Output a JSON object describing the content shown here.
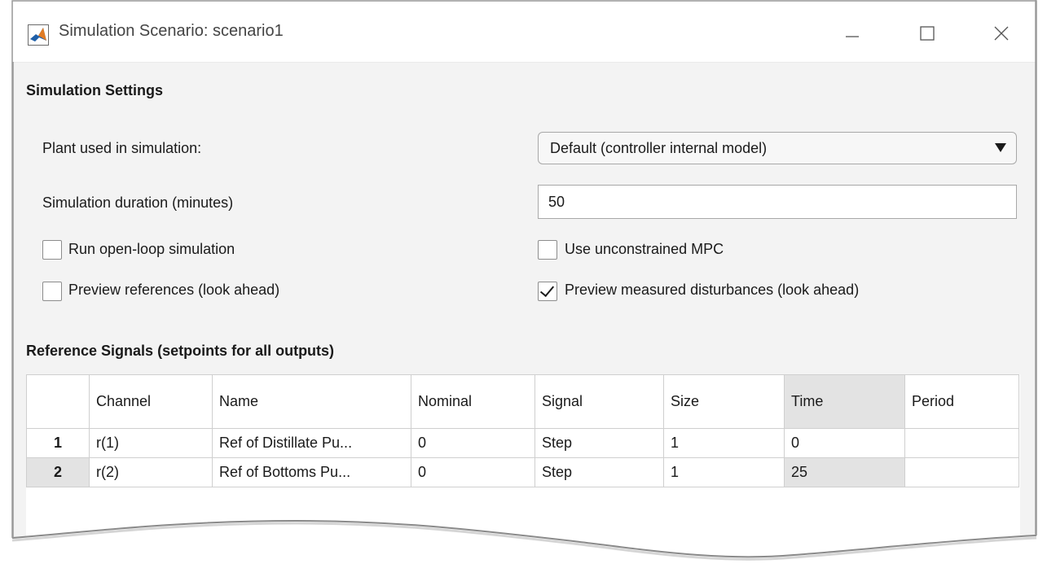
{
  "window": {
    "title": "Simulation Scenario: scenario1",
    "controls": {
      "minimize": "minimize-icon",
      "maximize": "maximize-icon",
      "close": "close-icon"
    }
  },
  "settings": {
    "title": "Simulation Settings",
    "plant_label": "Plant used in simulation:",
    "plant_value": "Default (controller internal model)",
    "duration_label": "Simulation duration (minutes)",
    "duration_value": "50",
    "checkboxes": {
      "open_loop": {
        "label": "Run open-loop simulation",
        "checked": false
      },
      "unconstrained": {
        "label": "Use unconstrained MPC",
        "checked": false
      },
      "preview_ref": {
        "label": "Preview references (look ahead)",
        "checked": false
      },
      "preview_md": {
        "label": "Preview measured disturbances (look ahead)",
        "checked": true
      }
    }
  },
  "reference": {
    "title": "Reference Signals (setpoints for all outputs)",
    "columns": [
      "",
      "Channel",
      "Name",
      "Nominal",
      "Signal",
      "Size",
      "Time",
      "Period"
    ],
    "rows": [
      {
        "num": "1",
        "channel": "r(1)",
        "name": "Ref of Distillate Pu...",
        "nominal": "0",
        "signal": "Step",
        "size": "1",
        "time": "0",
        "period": ""
      },
      {
        "num": "2",
        "channel": "r(2)",
        "name": "Ref of Bottoms Pu...",
        "nominal": "0",
        "signal": "Step",
        "size": "1",
        "time": "25",
        "period": ""
      }
    ]
  },
  "colors": {
    "border": "#a8a8a8",
    "selection": "#e3e3e3",
    "accent": "#1f5fa8"
  }
}
